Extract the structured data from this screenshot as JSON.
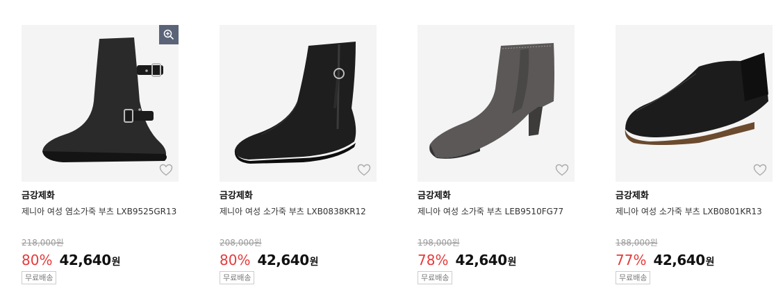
{
  "products": [
    {
      "brand": "금강제화",
      "name": "제니아 여성 염소가죽 부츠 LXB9525GR13",
      "original_price": "218,000원",
      "discount": "80%",
      "price": "42,640",
      "currency": "원",
      "shipping_badge": "무료배송",
      "image": "black-suede-buckle-boot",
      "shoe_color": "#2a2a2a",
      "has_zoom_button": true
    },
    {
      "brand": "금강제화",
      "name": "제니아 여성 소가죽 부츠 LXB0838KR12",
      "original_price": "208,000원",
      "discount": "80%",
      "price": "42,640",
      "currency": "원",
      "shipping_badge": "무료배송",
      "image": "black-leather-zip-ankle-boot",
      "shoe_color": "#1e1e1e",
      "has_zoom_button": false
    },
    {
      "brand": "금강제화",
      "name": "제니아 여성 소가죽 부츠 LEB9510FG77",
      "original_price": "198,000원",
      "discount": "78%",
      "price": "42,640",
      "currency": "원",
      "shipping_badge": "무료배송",
      "image": "grey-chelsea-heel-boot",
      "shoe_color": "#5b5857",
      "has_zoom_button": false
    },
    {
      "brand": "금강제화",
      "name": "제니아 여성 소가죽 부츠 LXB0801KR13",
      "original_price": "188,000원",
      "discount": "77%",
      "price": "42,640",
      "currency": "원",
      "shipping_badge": "무료배송",
      "image": "black-leather-chelsea-shoe",
      "shoe_color": "#1c1c1c",
      "has_zoom_button": false
    }
  ],
  "colors": {
    "discount": "#e53a3a",
    "zoom_bg": "#5a6378"
  }
}
